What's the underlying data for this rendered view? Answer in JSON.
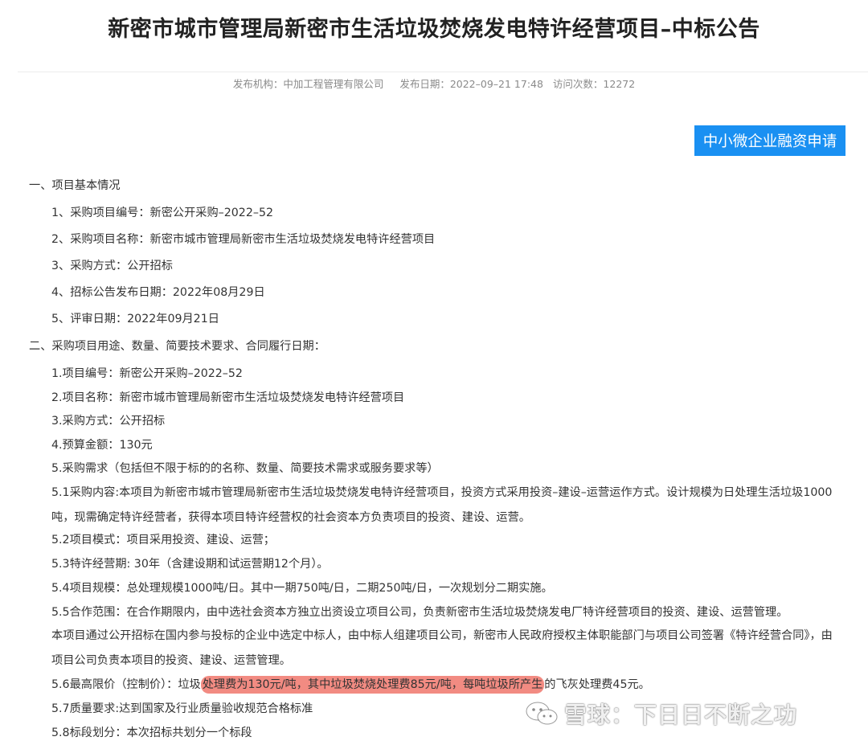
{
  "header": {
    "title": "新密市城市管理局新密市生活垃圾焚烧发电特许经营项目–中标公告",
    "publisher": "发布机构：中加工程管理有限公司",
    "date": "发布日期：2022–09–21 17:48",
    "visits": "访问次数：12272"
  },
  "finance_button": "中小微企业融资申请",
  "section1": {
    "heading": "一、项目基本情况",
    "items": [
      "1、采购项目编号：新密公开采购–2022–52",
      "2、采购项目名称：新密市城市管理局新密市生活垃圾焚烧发电特许经营项目",
      "3、采购方式：公开招标",
      "4、招标公告发布日期：2022年08月29日",
      "5、评审日期：2022年09月21日"
    ]
  },
  "section2": {
    "heading": "二、采购项目用途、数量、简要技术要求、合同履行日期：",
    "items": [
      "1.项目编号：新密公开采购–2022–52",
      "2.项目名称：新密市城市管理局新密市生活垃圾焚烧发电特许经营项目",
      "3.采购方式：公开招标",
      "4.预算金额：130元",
      "5.采购需求（包括但不限于标的的名称、数量、简要技术需求或服务要求等）"
    ],
    "p51": "5.1采购内容:本项目为新密市城市管理局新密市生活垃圾焚烧发电特许经营项目，投资方式采用投资–建设–运营运作方式。设计规模为日处理生活垃圾1000吨，现需确定特许经营者，获得本项目特许经营权的社会资本方负责项目的投资、建设、运营。",
    "p52": "5.2项目模式：项目采用投资、建设、运营；",
    "p53": "5.3特许经营期: 30年（含建设期和试运营期12个月）。",
    "p54": "5.4项目规模：总处理规模1000吨/日。其中一期750吨/日，二期250吨/日，一次规划分二期实施。",
    "p55": "5.5合作范围：在合作期限内，由中选社会资本方独立出资设立项目公司，负责新密市生活垃圾焚烧发电厂特许经营项目的投资、建设、运营管理。",
    "p55b": "本项目通过公开招标在国内参与投标的企业中选定中标人，由中标人组建项目公司，新密市人民政府授权主体职能部门与项目公司签署《特许经营合同》，由项目公司负责本项目的投资、建设、运营管理。",
    "p56_pre": "5.6最高限价（控制价）：垃圾",
    "p56_hl": "处理费为130元/吨，其中垃圾焚烧处理费85元/吨，每吨垃圾所产生",
    "p56_post": "的飞灰处理费45元。",
    "p57": "5.7质量要求:达到国家及行业质量验收规范合格标准",
    "p58": "5.8标段划分：本次招标共划分一个标段"
  },
  "watermark": "雪球：下日日不断之功",
  "colors": {
    "button": "#1a90f2",
    "highlight": "#f28b82"
  }
}
